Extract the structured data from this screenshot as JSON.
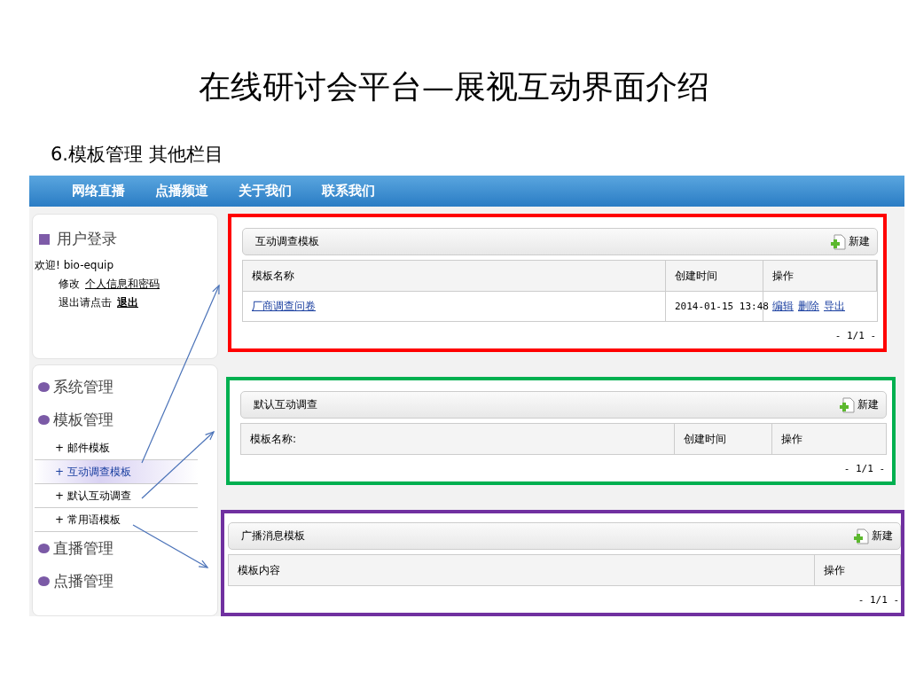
{
  "slide": {
    "title": "在线研讨会平台—展视互动界面介绍",
    "subtitle": "6.模板管理 其他栏目"
  },
  "nav": {
    "items": [
      "网络直播",
      "点播频道",
      "关于我们",
      "联系我们"
    ]
  },
  "login": {
    "title": "用户登录",
    "welcome": "欢迎! bio-equip",
    "edit_label": "修改",
    "edit_link": "个人信息和密码",
    "logout_label": "退出请点击",
    "logout_link": "退出"
  },
  "menu": [
    {
      "label": "系统管理"
    },
    {
      "label": "模板管理",
      "children": [
        {
          "label": "+ 邮件模板",
          "selected": false
        },
        {
          "label": "+ 互动调查模板",
          "selected": true
        },
        {
          "label": "+ 默认互动调查",
          "selected": false
        },
        {
          "label": "+ 常用语模板",
          "selected": false
        }
      ]
    },
    {
      "label": "直播管理"
    },
    {
      "label": "点播管理"
    }
  ],
  "panels": [
    {
      "title": "互动调查模板",
      "new_button": "新建",
      "color": "#ff0000",
      "columns": [
        "模板名称",
        "创建时间",
        "操作"
      ],
      "rows": [
        {
          "name": "厂商调查问卷",
          "created": "2014-01-15 13:48",
          "actions": [
            "编辑",
            "删除",
            "导出"
          ]
        }
      ],
      "pager": "- 1/1 -"
    },
    {
      "title": "默认互动调查",
      "new_button": "新建",
      "color": "#00b050",
      "columns": [
        "模板名称:",
        "创建时间",
        "操作"
      ],
      "pager": "- 1/1 -"
    },
    {
      "title": "广播消息模板",
      "new_button": "新建",
      "color": "#7030a0",
      "columns": [
        "模板内容",
        "操作"
      ],
      "pager": "- 1/1 -"
    }
  ]
}
